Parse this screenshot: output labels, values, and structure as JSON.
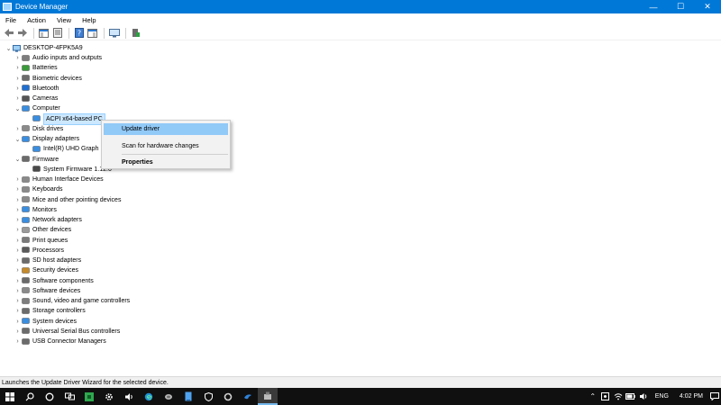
{
  "window": {
    "title": "Device Manager"
  },
  "window_controls": {
    "minimize": "—",
    "maximize": "☐",
    "close": "✕"
  },
  "menu": [
    "File",
    "Action",
    "View",
    "Help"
  ],
  "tree": {
    "root": "DESKTOP-4FPK5A9",
    "items": [
      {
        "label": "Audio inputs and outputs",
        "expanded": false,
        "icon": "speaker-icon"
      },
      {
        "label": "Batteries",
        "expanded": false,
        "icon": "battery-icon"
      },
      {
        "label": "Biometric devices",
        "expanded": false,
        "icon": "fingerprint-icon"
      },
      {
        "label": "Bluetooth",
        "expanded": false,
        "icon": "bluetooth-icon"
      },
      {
        "label": "Cameras",
        "expanded": false,
        "icon": "camera-icon"
      },
      {
        "label": "Computer",
        "expanded": true,
        "icon": "computer-icon"
      },
      {
        "label": "ACPI x64-based PC",
        "child": true,
        "selected": true,
        "icon": "monitor-icon"
      },
      {
        "label": "Disk drives",
        "expanded": false,
        "icon": "disk-icon"
      },
      {
        "label": "Display adapters",
        "expanded": true,
        "icon": "display-adapter-icon"
      },
      {
        "label": "Intel(R) UHD Graph",
        "child": true,
        "icon": "monitor-icon"
      },
      {
        "label": "Firmware",
        "expanded": true,
        "icon": "firmware-icon"
      },
      {
        "label": "System Firmware 1.12.0",
        "child": true,
        "icon": "chip-icon"
      },
      {
        "label": "Human Interface Devices",
        "expanded": false,
        "icon": "hid-icon"
      },
      {
        "label": "Keyboards",
        "expanded": false,
        "icon": "keyboard-icon"
      },
      {
        "label": "Mice and other pointing devices",
        "expanded": false,
        "icon": "mouse-icon"
      },
      {
        "label": "Monitors",
        "expanded": false,
        "icon": "monitor-icon"
      },
      {
        "label": "Network adapters",
        "expanded": false,
        "icon": "network-icon"
      },
      {
        "label": "Other devices",
        "expanded": false,
        "icon": "other-device-icon"
      },
      {
        "label": "Print queues",
        "expanded": false,
        "icon": "printer-icon"
      },
      {
        "label": "Processors",
        "expanded": false,
        "icon": "processor-icon"
      },
      {
        "label": "SD host adapters",
        "expanded": false,
        "icon": "sd-card-icon"
      },
      {
        "label": "Security devices",
        "expanded": false,
        "icon": "security-icon"
      },
      {
        "label": "Software components",
        "expanded": false,
        "icon": "software-component-icon"
      },
      {
        "label": "Software devices",
        "expanded": false,
        "icon": "software-device-icon"
      },
      {
        "label": "Sound, video and game controllers",
        "expanded": false,
        "icon": "sound-icon"
      },
      {
        "label": "Storage controllers",
        "expanded": false,
        "icon": "storage-icon"
      },
      {
        "label": "System devices",
        "expanded": false,
        "icon": "system-device-icon"
      },
      {
        "label": "Universal Serial Bus controllers",
        "expanded": false,
        "icon": "usb-icon"
      },
      {
        "label": "USB Connector Managers",
        "expanded": false,
        "icon": "usb-icon"
      }
    ]
  },
  "context_menu": {
    "update_driver": "Update driver",
    "scan": "Scan for hardware changes",
    "properties": "Properties"
  },
  "status": "Launches the Update Driver Wizard for the selected device.",
  "taskbar": {
    "lang": "ENG",
    "time": "4:02 PM"
  },
  "colors": {
    "accent": "#0078d7",
    "selection": "#cce8ff",
    "menu_hover": "#91c9f7",
    "taskbar": "#101010"
  }
}
